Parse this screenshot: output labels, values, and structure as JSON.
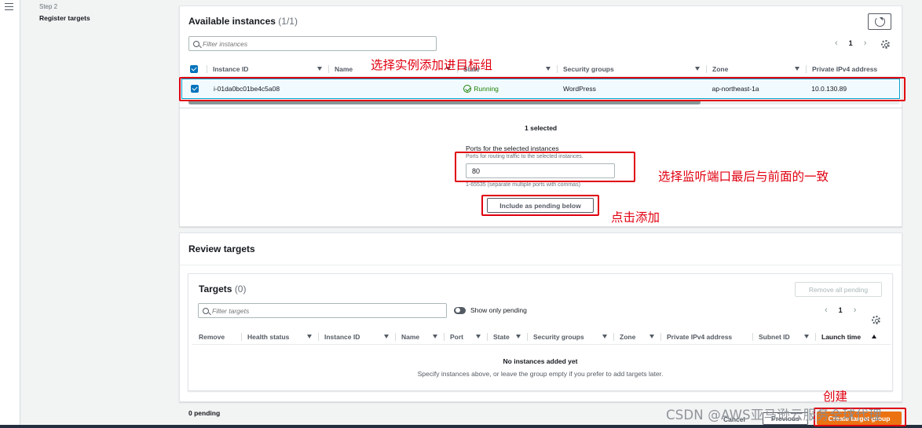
{
  "nav": {
    "menu_icon": "hamburger-icon"
  },
  "wizard": {
    "step_number": "Step 2",
    "step_title": "Register targets"
  },
  "available_instances": {
    "title": "Available instances",
    "count": "(1/1)",
    "search_placeholder": "Filter instances",
    "page": "1",
    "columns": [
      "Instance ID",
      "Name",
      "State",
      "Security groups",
      "Zone",
      "Private IPv4 address"
    ],
    "rows": [
      {
        "instance_id": "i-01da0bc01be4c5a08",
        "name": "",
        "state": "Running",
        "security_groups": "WordPress",
        "zone": "ap-northeast-1a",
        "private_ip": "10.0.130.89",
        "selected": true
      }
    ],
    "selected_summary": "1 selected",
    "ports_label": "Ports for the selected instances",
    "ports_description": "Ports for routing traffic to the selected instances.",
    "ports_value": "80",
    "ports_hint": "1-65535 (separate multiple ports with commas)",
    "include_button": "Include as pending below",
    "scroll_position": 0.72
  },
  "review_targets": {
    "title": "Review targets",
    "targets_title": "Targets",
    "targets_count": "(0)",
    "remove_all_button": "Remove all pending",
    "search_placeholder": "Filter targets",
    "show_only_pending": "Show only pending",
    "page": "1",
    "columns": [
      "Remove",
      "Health status",
      "Instance ID",
      "Name",
      "Port",
      "State",
      "Security groups",
      "Zone",
      "Private IPv4 address",
      "Subnet ID",
      "Launch time"
    ],
    "empty_title": "No instances added yet",
    "empty_desc": "Specify instances above, or leave the group empty if you prefer to add targets later."
  },
  "footer": {
    "pending": "0 pending",
    "cancel": "Cancel",
    "previous": "Previous",
    "create": "Create target group"
  },
  "annotations": {
    "select_instance": "选择实例添加进目标组",
    "select_port": "选择监听端口最后与前面的一致",
    "click_add": "点击添加",
    "create": "创建"
  },
  "watermark": "CSDN @AWS亚马逊云服务全球代理",
  "colors": {
    "accent": "#0073bb",
    "running": "#1d8102",
    "primary": "#ec7211",
    "annotation": "#e0000f"
  }
}
